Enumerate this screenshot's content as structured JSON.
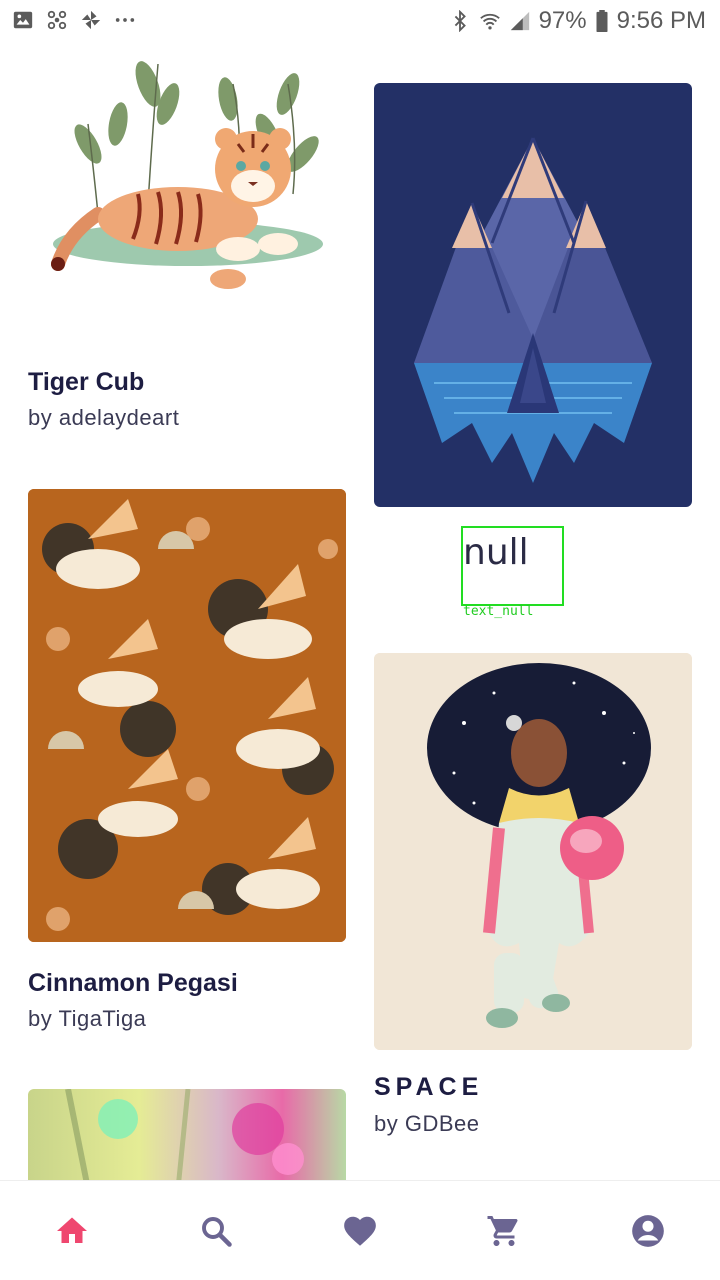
{
  "status_bar": {
    "battery": "97%",
    "time": "9:56 PM",
    "icons": [
      "image-icon",
      "fan-icon",
      "pinwheel-icon",
      "more-icon",
      "bluetooth-icon",
      "wifi-icon",
      "signal-icon",
      "battery-icon"
    ]
  },
  "cards": [
    {
      "title": "Tiger Cub",
      "artist": "by adelaydeart"
    },
    {
      "title": "null",
      "artist": "",
      "debug_tag": "text_null"
    },
    {
      "title": "Cinnamon Pegasi",
      "artist": "by TigaTiga"
    },
    {
      "title": "SPACE",
      "artist": "by GDBee"
    }
  ],
  "bottom_nav": {
    "items": [
      "home-icon",
      "search-icon",
      "heart-icon",
      "cart-icon",
      "account-icon"
    ],
    "active": "home-icon",
    "active_color": "#ef476f",
    "inactive_color": "#6b6592"
  },
  "colors": {
    "title": "#1d1d42",
    "mountain_bg": "#233066",
    "space_bg": "#f1e6d6",
    "pegasi_bg": "#b5651d"
  }
}
